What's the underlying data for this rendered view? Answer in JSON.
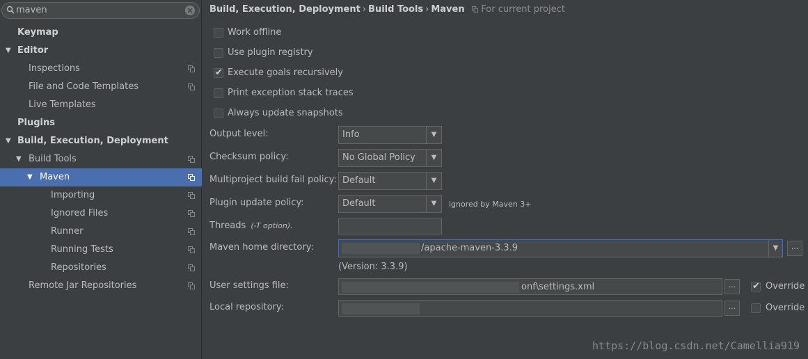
{
  "search": {
    "value": "maven"
  },
  "sidebar": {
    "items": [
      {
        "label": "Keymap"
      },
      {
        "label": "Editor"
      },
      {
        "label": "Inspections"
      },
      {
        "label": "File and Code Templates"
      },
      {
        "label": "Live Templates"
      },
      {
        "label": "Plugins"
      },
      {
        "label": "Build, Execution, Deployment"
      },
      {
        "label": "Build Tools"
      },
      {
        "label": "Maven"
      },
      {
        "label": "Importing"
      },
      {
        "label": "Ignored Files"
      },
      {
        "label": "Runner"
      },
      {
        "label": "Running Tests"
      },
      {
        "label": "Repositories"
      },
      {
        "label": "Remote Jar Repositories"
      }
    ]
  },
  "breadcrumb": {
    "parts": [
      "Build, Execution, Deployment",
      "Build Tools",
      "Maven"
    ],
    "separator": "›",
    "scope": "For current project"
  },
  "options": {
    "work_offline": {
      "label": "Work offline",
      "checked": false
    },
    "use_plugin_registry": {
      "label": "Use plugin registry",
      "checked": false
    },
    "execute_goals_recursively": {
      "label": "Execute goals recursively",
      "checked": true
    },
    "print_exception_stack_traces": {
      "label": "Print exception stack traces",
      "checked": false
    },
    "always_update_snapshots": {
      "label": "Always update snapshots",
      "checked": false
    }
  },
  "fields": {
    "output_level": {
      "label": "Output level:",
      "value": "Info"
    },
    "checksum_policy": {
      "label": "Checksum policy:",
      "value": "No Global Policy"
    },
    "multiproject_fail_policy": {
      "label": "Multiproject build fail policy:",
      "value": "Default"
    },
    "plugin_update_policy": {
      "label": "Plugin update policy:",
      "value": "Default",
      "hint": "ignored by Maven 3+"
    },
    "threads": {
      "label": "Threads",
      "hint": "(-T option).",
      "value": ""
    },
    "maven_home": {
      "label": "Maven home directory:",
      "value": "/apache-maven-3.3.9",
      "version": "(Version: 3.3.9)"
    },
    "user_settings": {
      "label": "User settings file:",
      "value": "onf\\settings.xml",
      "override_label": "Override",
      "override_checked": true
    },
    "local_repository": {
      "label": "Local repository:",
      "value": "",
      "override_label": "Override",
      "override_checked": false
    }
  },
  "browse_label": "...",
  "watermark": "https://blog.csdn.net/Camellia919",
  "colors": {
    "background": "#3c3f41",
    "selection": "#4b6eaf",
    "input_bg": "#45494a",
    "text": "#bbbbbb"
  }
}
